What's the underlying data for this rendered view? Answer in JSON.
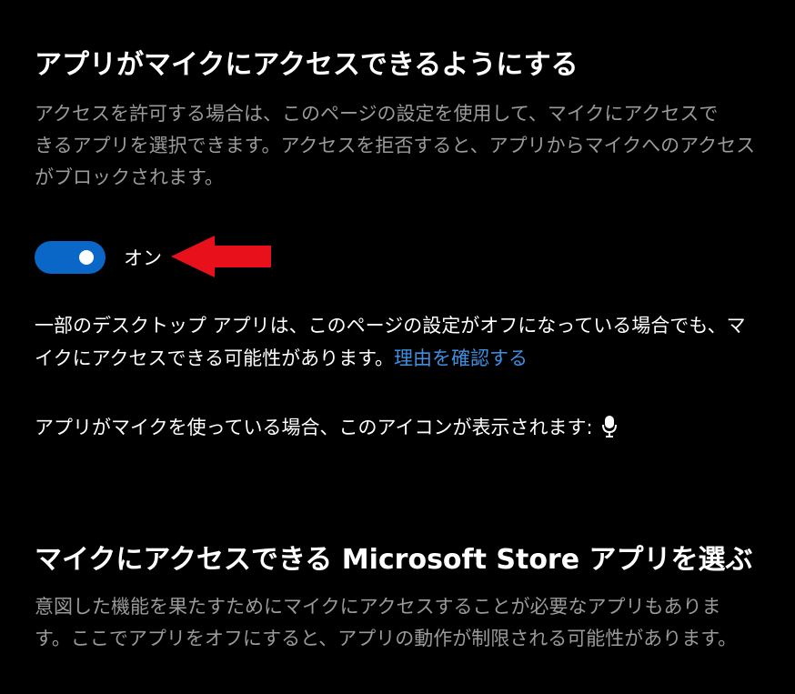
{
  "section1": {
    "heading": "アプリがマイクにアクセスできるようにする",
    "description_lines": [
      "アクセスを許可する場合は、このページの設定を使用して、マイクにアクセスで",
      "きるアプリを選択できます。アクセスを拒否すると、アプリからマイクへのアクセス",
      "がブロックされます。"
    ]
  },
  "toggle": {
    "state": "on",
    "label": "オン",
    "accent_color": "#0a67c8"
  },
  "annotation": {
    "arrow_color": "#e8101b",
    "arrow_direction": "left"
  },
  "desktop_note": {
    "line1": "一部のデスクトップ アプリは、このページの設定がオフになっている場合でも、マ",
    "line2": "イクにアクセスできる可能性があります。",
    "link": "理由を確認する"
  },
  "icon_note": {
    "text": "アプリがマイクを使っている場合、このアイコンが表示されます:",
    "icon": "microphone-icon"
  },
  "section2": {
    "heading": "マイクにアクセスできる Microsoft Store アプリを選ぶ",
    "description_lines": [
      "意図した機能を果たすためにマイクにアクセスすることが必要なアプリもありま",
      "す。ここでアプリをオフにすると、アプリの動作が制限される可能性があります。"
    ]
  }
}
